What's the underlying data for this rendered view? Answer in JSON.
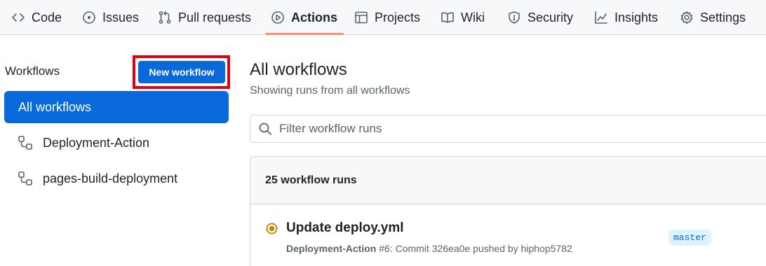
{
  "nav": {
    "tabs": [
      {
        "label": "Code",
        "icon": "code-icon"
      },
      {
        "label": "Issues",
        "icon": "issue-icon"
      },
      {
        "label": "Pull requests",
        "icon": "pull-request-icon"
      },
      {
        "label": "Actions",
        "icon": "play-icon",
        "active": true
      },
      {
        "label": "Projects",
        "icon": "table-icon"
      },
      {
        "label": "Wiki",
        "icon": "book-icon"
      },
      {
        "label": "Security",
        "icon": "shield-icon"
      },
      {
        "label": "Insights",
        "icon": "graph-icon"
      },
      {
        "label": "Settings",
        "icon": "gear-icon"
      }
    ]
  },
  "sidebar": {
    "heading": "Workflows",
    "new_workflow_label": "New workflow",
    "items": [
      {
        "label": "All workflows",
        "active": true
      },
      {
        "label": "Deployment-Action",
        "icon": "workflow-icon"
      },
      {
        "label": "pages-build-deployment",
        "icon": "workflow-icon"
      }
    ]
  },
  "main": {
    "title": "All workflows",
    "subtitle": "Showing runs from all workflows",
    "filter_placeholder": "Filter workflow runs",
    "runs_count": "25 workflow runs",
    "runs": [
      {
        "title": "Update deploy.yml",
        "workflow": "Deployment-Action",
        "meta": " #6: Commit 326ea0e pushed by hiphop5782",
        "branch": "master",
        "status": "in-progress"
      }
    ]
  },
  "colors": {
    "accent": "#0969da",
    "active_tab_underline": "#fd8c73",
    "highlight_outline": "#e20010",
    "in_progress": "#bf8700"
  }
}
